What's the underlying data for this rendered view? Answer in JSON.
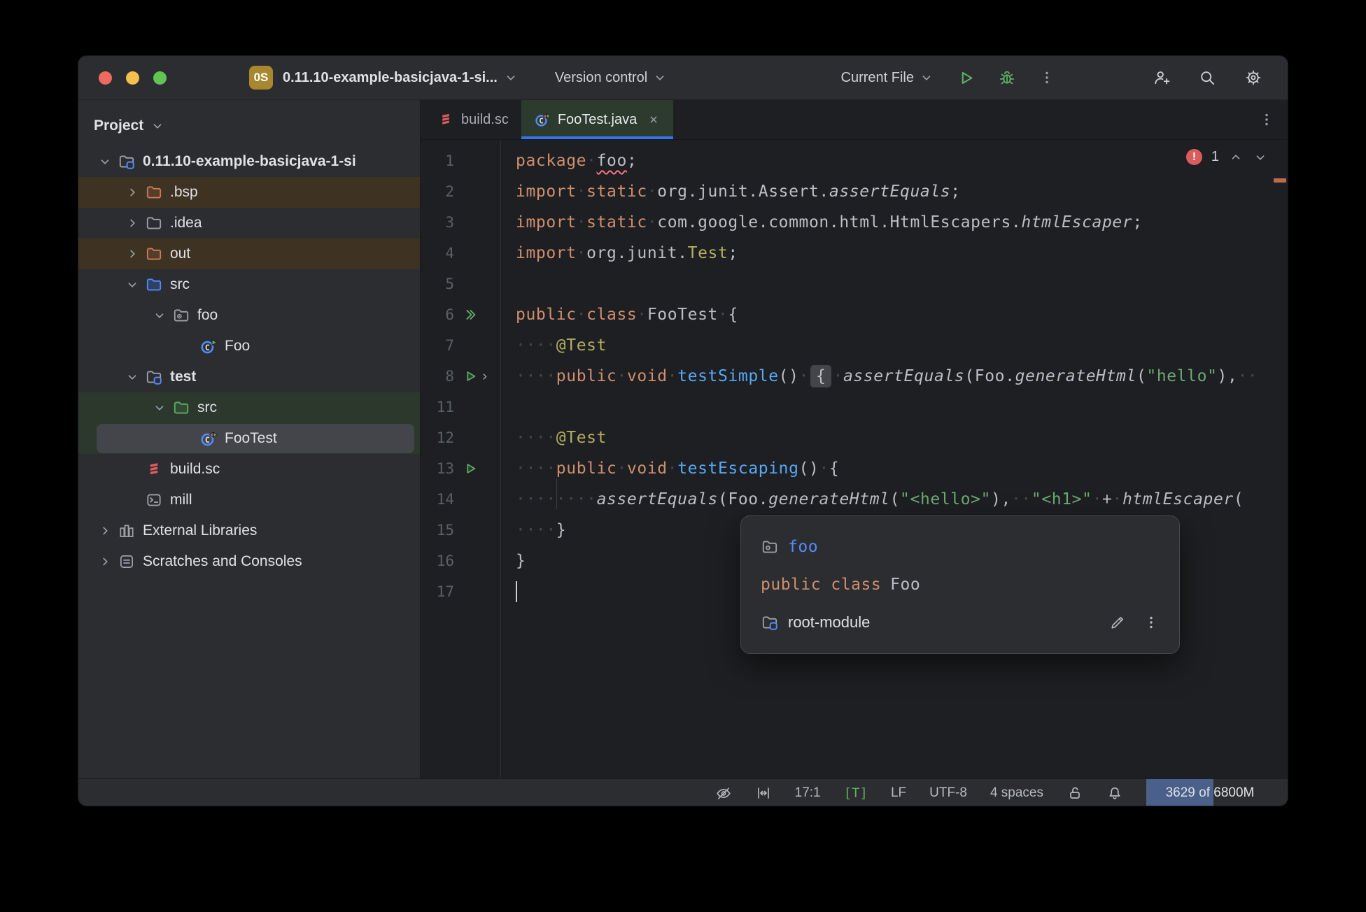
{
  "titlebar": {
    "project_badge": "0S",
    "project_name": "0.11.10-example-basicjava-1-si...",
    "vcs_label": "Version control",
    "run_config_label": "Current File"
  },
  "panel": {
    "header": "Project",
    "items": [
      {
        "label": "0.11.10-example-basicjava-1-si",
        "icon": "module-folder",
        "indent": 0,
        "chevron": "expanded",
        "row": "normal",
        "bold": true
      },
      {
        "label": ".bsp",
        "icon": "folder-excluded",
        "indent": 1,
        "chevron": "collapsed",
        "row": "excluded"
      },
      {
        "label": ".idea",
        "icon": "folder",
        "indent": 1,
        "chevron": "collapsed",
        "row": "normal"
      },
      {
        "label": "out",
        "icon": "folder-excluded",
        "indent": 1,
        "chevron": "collapsed",
        "row": "excluded"
      },
      {
        "label": "src",
        "icon": "folder-source",
        "indent": 1,
        "chevron": "expanded",
        "row": "normal"
      },
      {
        "label": "foo",
        "icon": "package",
        "indent": 2,
        "chevron": "expanded",
        "row": "normal"
      },
      {
        "label": "Foo",
        "icon": "class-run",
        "indent": 3,
        "chevron": "none",
        "row": "normal"
      },
      {
        "label": "test",
        "icon": "module-folder",
        "indent": 1,
        "chevron": "expanded",
        "row": "normal",
        "bold": true
      },
      {
        "label": "src",
        "icon": "folder-test",
        "indent": 2,
        "chevron": "expanded",
        "row": "test"
      },
      {
        "label": "FooTest",
        "icon": "class-test",
        "indent": 3,
        "chevron": "none",
        "row": "test",
        "selected": true
      },
      {
        "label": "build.sc",
        "icon": "scala-file",
        "indent": 1,
        "chevron": "none",
        "row": "normal"
      },
      {
        "label": "mill",
        "icon": "terminal-file",
        "indent": 1,
        "chevron": "none",
        "row": "normal"
      },
      {
        "label": "External Libraries",
        "icon": "libraries",
        "indent": 0,
        "chevron": "collapsed",
        "row": "normal"
      },
      {
        "label": "Scratches and Consoles",
        "icon": "scratches",
        "indent": 0,
        "chevron": "collapsed",
        "row": "normal"
      }
    ]
  },
  "tabs": [
    {
      "label": "build.sc",
      "icon": "scala-file",
      "active": false
    },
    {
      "label": "FooTest.java",
      "icon": "class-test",
      "active": true,
      "closable": true
    }
  ],
  "editor": {
    "error_count": "1",
    "lines": [
      {
        "num": "1",
        "gutter": "",
        "tokens": [
          [
            "kw",
            "package"
          ],
          [
            "ws",
            "·"
          ],
          [
            "err",
            "foo"
          ],
          [
            "pl",
            ";"
          ]
        ]
      },
      {
        "num": "2",
        "gutter": "",
        "tokens": [
          [
            "kw",
            "import"
          ],
          [
            "ws",
            "·"
          ],
          [
            "kw",
            "static"
          ],
          [
            "ws",
            "·"
          ],
          [
            "pl",
            "org.junit.Assert."
          ],
          [
            "it",
            "assertEquals"
          ],
          [
            "pl",
            ";"
          ]
        ]
      },
      {
        "num": "3",
        "gutter": "",
        "tokens": [
          [
            "kw",
            "import"
          ],
          [
            "ws",
            "·"
          ],
          [
            "kw",
            "static"
          ],
          [
            "ws",
            "·"
          ],
          [
            "pl",
            "com.google.common.html.HtmlEscapers."
          ],
          [
            "it",
            "htmlEscaper"
          ],
          [
            "pl",
            ";"
          ]
        ]
      },
      {
        "num": "4",
        "gutter": "",
        "tokens": [
          [
            "kw",
            "import"
          ],
          [
            "ws",
            "·"
          ],
          [
            "pl",
            "org.junit."
          ],
          [
            "ann",
            "Test"
          ],
          [
            "pl",
            ";"
          ]
        ]
      },
      {
        "num": "5",
        "gutter": "",
        "tokens": []
      },
      {
        "num": "6",
        "gutter": "run-all",
        "tokens": [
          [
            "kw",
            "public"
          ],
          [
            "ws",
            "·"
          ],
          [
            "kw",
            "class"
          ],
          [
            "ws",
            "·"
          ],
          [
            "pl",
            "FooTest"
          ],
          [
            "ws",
            "·"
          ],
          [
            "pl",
            "{"
          ]
        ]
      },
      {
        "num": "7",
        "gutter": "",
        "tokens": [
          [
            "ws",
            "····"
          ],
          [
            "ann",
            "@Test"
          ]
        ]
      },
      {
        "num": "8",
        "gutter": "run-fold",
        "tokens": [
          [
            "ws",
            "····"
          ],
          [
            "kw",
            "public"
          ],
          [
            "ws",
            "·"
          ],
          [
            "kw",
            "void"
          ],
          [
            "ws",
            "·"
          ],
          [
            "mth",
            "testSimple"
          ],
          [
            "pl",
            "()"
          ],
          [
            "ws",
            "·"
          ],
          [
            "fold",
            "{"
          ],
          [
            "ws",
            "·"
          ],
          [
            "it",
            "assertEquals"
          ],
          [
            "pl",
            "(Foo."
          ],
          [
            "it",
            "generateHtml"
          ],
          [
            "pl",
            "("
          ],
          [
            "str",
            "\"hello\""
          ],
          [
            "pl",
            "),"
          ],
          [
            "ws",
            "··"
          ]
        ]
      },
      {
        "num": "11",
        "gutter": "",
        "tokens": []
      },
      {
        "num": "12",
        "gutter": "",
        "tokens": [
          [
            "ws",
            "····"
          ],
          [
            "ann",
            "@Test"
          ]
        ]
      },
      {
        "num": "13",
        "gutter": "run",
        "tokens": [
          [
            "ws",
            "····"
          ],
          [
            "kw",
            "public"
          ],
          [
            "ws",
            "·"
          ],
          [
            "kw",
            "void"
          ],
          [
            "ws",
            "·"
          ],
          [
            "mth",
            "testEscaping"
          ],
          [
            "pl",
            "()"
          ],
          [
            "ws",
            "·"
          ],
          [
            "pl",
            "{"
          ]
        ]
      },
      {
        "num": "14",
        "gutter": "",
        "tokens": [
          [
            "ws",
            "····"
          ],
          [
            "guide",
            ""
          ],
          [
            "ws",
            "····"
          ],
          [
            "it",
            "assertEquals"
          ],
          [
            "pl",
            "(Foo."
          ],
          [
            "it",
            "generateHtml"
          ],
          [
            "pl",
            "("
          ],
          [
            "str",
            "\"<hello>\""
          ],
          [
            "pl",
            "),"
          ],
          [
            "ws",
            "··"
          ],
          [
            "str",
            "\"<h1>\""
          ],
          [
            "ws",
            "·"
          ],
          [
            "pl",
            "+"
          ],
          [
            "ws",
            "·"
          ],
          [
            "it",
            "htmlEscaper"
          ],
          [
            "pl",
            "("
          ]
        ]
      },
      {
        "num": "15",
        "gutter": "",
        "tokens": [
          [
            "ws",
            "····"
          ],
          [
            "pl",
            "}"
          ]
        ]
      },
      {
        "num": "16",
        "gutter": "",
        "tokens": [
          [
            "pl",
            "}"
          ]
        ]
      },
      {
        "num": "17",
        "gutter": "",
        "caret": true,
        "tokens": []
      }
    ]
  },
  "popup": {
    "package_label": "foo",
    "signature_keyword": "public class ",
    "signature_name": "Foo",
    "module_label": "root-module"
  },
  "statusbar": {
    "position": "17:1",
    "mode": "[T]",
    "line_ending": "LF",
    "encoding": "UTF-8",
    "indent": "4 spaces",
    "memory": "3629 of 6800M",
    "memory_fill_pct": 53
  },
  "colors": {
    "accent_blue": "#3574F0",
    "error_red": "#DB5C5C",
    "run_green": "#5FAD65",
    "keyword_orange": "#CF8E6D",
    "string_green": "#6AAB73",
    "annotation_yellow": "#B3AE60",
    "method_blue": "#56A8F5",
    "excluded_row": "#3E3323",
    "test_row": "#2C382C"
  }
}
